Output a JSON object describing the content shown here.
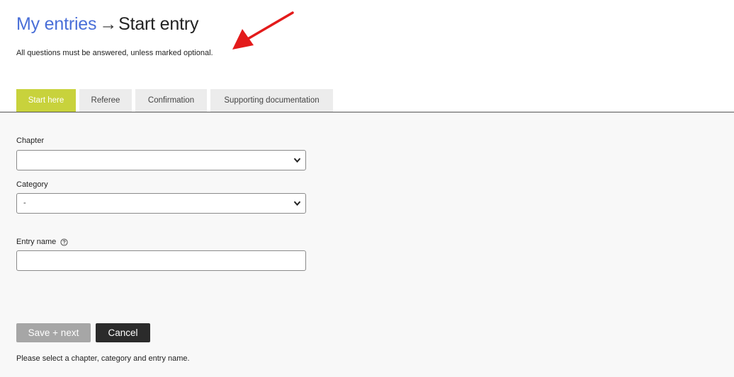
{
  "header": {
    "breadcrumb": {
      "parent": "My entries",
      "separator": "→",
      "current": "Start entry"
    },
    "subtitle": "All questions must be answered, unless marked optional."
  },
  "tabs": [
    {
      "label": "Start here",
      "active": true
    },
    {
      "label": "Referee",
      "active": false
    },
    {
      "label": "Confirmation",
      "active": false
    },
    {
      "label": "Supporting documentation",
      "active": false
    }
  ],
  "form": {
    "chapter": {
      "label": "Chapter",
      "value": ""
    },
    "category": {
      "label": "Category",
      "value": "-"
    },
    "entry_name": {
      "label": "Entry name",
      "value": "",
      "help_icon": "question-circle-icon"
    }
  },
  "actions": {
    "save_label": "Save + next",
    "cancel_label": "Cancel"
  },
  "helper_text": "Please select a chapter, category and entry name.",
  "colors": {
    "link": "#4a6fd8",
    "active_tab": "#c8d23c",
    "annotation_arrow": "#e31b1b",
    "save_disabled": "#a6a6a6",
    "cancel": "#2b2b2b"
  }
}
